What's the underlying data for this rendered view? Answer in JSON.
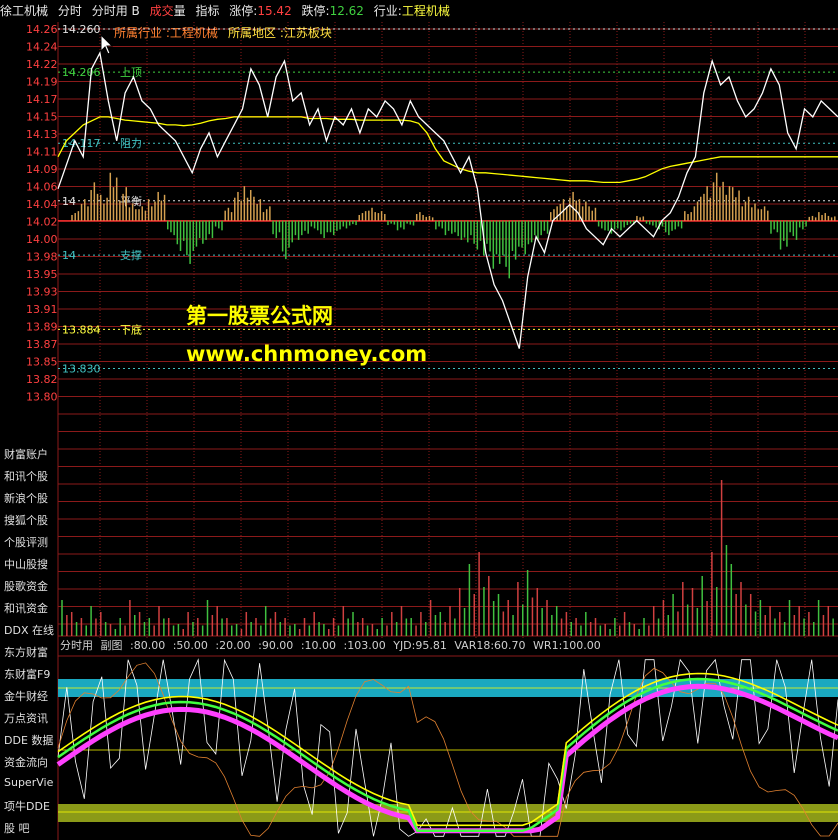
{
  "titlebar": {
    "stock_name": "徐工机械",
    "tab_intraday": "分时",
    "tab_intraday_volume": "分时用",
    "tab_b": "B",
    "tab_volume_a": "成交",
    "tab_volume_b": "量",
    "tab_indicator": "指标",
    "limit_up_label": "涨停:",
    "limit_up_value": "15.42",
    "limit_down_label": "跌停:",
    "limit_down_value": "12.62",
    "industry_label": "行业:",
    "industry_value": "工程机械"
  },
  "info_line": {
    "industry": "所属行业 :工程机械",
    "region": "所属地区 :江苏板块"
  },
  "price_axis": [
    "14.26",
    "14.24",
    "14.22",
    "14.19",
    "14.17",
    "14.15",
    "14.13",
    "14.11",
    "14.09",
    "14.06",
    "14.04",
    "14.02",
    "14.00",
    "13.98",
    "13.95",
    "13.93",
    "13.91",
    "13.89",
    "13.87",
    "13.85",
    "13.82",
    "13.80"
  ],
  "levels": [
    {
      "value": "14.260",
      "label": "",
      "color": "#e0e0e0",
      "price": 14.26
    },
    {
      "value": "14.206",
      "label": "上顶",
      "color": "#40d040",
      "price": 14.206
    },
    {
      "value": "14.117",
      "label": "阻力",
      "color": "#40c0c0",
      "price": 14.117
    },
    {
      "value": "14",
      "label": "平衡",
      "color": "#e0e0e0",
      "price": 14.045
    },
    {
      "value": "14",
      "label": "支撑",
      "color": "#40c0c0",
      "price": 13.977
    },
    {
      "value": "13.884",
      "label": "下底",
      "color": "#ffff40",
      "price": 13.884
    },
    {
      "value": "13.830",
      "label": "",
      "color": "#40c0c0",
      "price": 13.835
    }
  ],
  "watermark": {
    "line1": "第一股票公式网",
    "line2": "www.chnmoney.com"
  },
  "left_links": [
    "财富账户",
    "和讯个股",
    "新浪个股",
    "搜狐个股",
    "个股评测",
    "中山股搜",
    "股歌资金",
    "和讯资金",
    "DDX 在线",
    "东方财富",
    "东财富F9",
    "金牛财经",
    "万点资讯",
    "DDE 数据",
    "资金流向",
    "SuperVie",
    "项牛DDE",
    "股  吧"
  ],
  "subchart_header": {
    "name": "分时用",
    "mode": "副图",
    "params": [
      ":80.00",
      ":50.00",
      ":20.00",
      ":90.00",
      ":10.00",
      ":103.00"
    ],
    "yjd": "YJD:95.81",
    "var18": "VAR18:60.70",
    "wr1": "WR1:100.00"
  },
  "colors": {
    "price_line": "#ffffff",
    "avg_line": "#ffff00",
    "grid": "#8b1a1a",
    "up_bar": "#d4a050",
    "down_bar": "#40c040",
    "band_top": "#1aa8c0",
    "band_bottom": "#8b9a18"
  },
  "price_series": [
    14.06,
    14.09,
    14.12,
    14.1,
    14.21,
    14.23,
    14.17,
    14.12,
    14.18,
    14.2,
    14.17,
    14.16,
    14.14,
    14.13,
    14.12,
    14.1,
    14.08,
    14.11,
    14.13,
    14.1,
    14.12,
    14.14,
    14.16,
    14.21,
    14.19,
    14.15,
    14.2,
    14.22,
    14.17,
    14.18,
    14.14,
    14.16,
    14.12,
    14.15,
    14.14,
    14.16,
    14.13,
    14.16,
    14.15,
    14.17,
    14.16,
    14.14,
    14.17,
    14.15,
    14.14,
    14.13,
    14.12,
    14.1,
    14.08,
    14.1,
    14.06,
    13.98,
    13.94,
    13.92,
    13.89,
    13.86,
    13.95,
    14.0,
    13.98,
    14.02,
    14.03,
    14.04,
    14.03,
    14.01,
    14.0,
    13.99,
    14.01,
    14.0,
    14.01,
    14.02,
    14.01,
    14.0,
    14.02,
    14.03,
    14.05,
    14.08,
    14.1,
    14.18,
    14.22,
    14.19,
    14.2,
    14.17,
    14.15,
    14.16,
    14.18,
    14.21,
    14.19,
    14.13,
    14.11,
    14.16,
    14.15,
    14.17,
    14.16,
    14.15
  ],
  "avg_series": [
    14.1,
    14.12,
    14.13,
    14.14,
    14.145,
    14.15,
    14.15,
    14.148,
    14.146,
    14.145,
    14.144,
    14.143,
    14.142,
    14.14,
    14.14,
    14.139,
    14.14,
    14.142,
    14.145,
    14.147,
    14.148,
    14.15,
    14.15,
    14.15,
    14.15,
    14.15,
    14.15,
    14.15,
    14.15,
    14.15,
    14.148,
    14.148,
    14.148,
    14.147,
    14.147,
    14.147,
    14.146,
    14.146,
    14.146,
    14.146,
    14.146,
    14.146,
    14.145,
    14.142,
    14.13,
    14.11,
    14.095,
    14.09,
    14.085,
    14.082,
    14.08,
    14.08,
    14.079,
    14.078,
    14.077,
    14.076,
    14.075,
    14.074,
    14.073,
    14.072,
    14.071,
    14.07,
    14.07,
    14.07,
    14.069,
    14.068,
    14.068,
    14.068,
    14.07,
    14.072,
    14.075,
    14.08,
    14.085,
    14.088,
    14.09,
    14.092,
    14.094,
    14.096,
    14.098,
    14.1,
    14.1,
    14.1,
    14.1,
    14.1,
    14.1,
    14.1,
    14.1,
    14.1,
    14.1,
    14.1,
    14.1,
    14.1,
    14.1,
    14.1
  ],
  "flow_bars": [
    0.2,
    0.5,
    0.8,
    0.6,
    1.0,
    0.7,
    0.4,
    0.3,
    0.5,
    0.6,
    -0.3,
    -0.7,
    -0.9,
    -0.6,
    -0.4,
    -0.2,
    0.3,
    0.6,
    0.8,
    0.5,
    0.3,
    -0.4,
    -0.8,
    -0.5,
    -0.3,
    -0.2,
    -0.4,
    -0.3,
    -0.2,
    -0.1,
    0.2,
    0.3,
    0.2,
    -0.1,
    -0.2,
    -0.1,
    0.2,
    0.1,
    -0.2,
    -0.3,
    -0.4,
    -0.5,
    -0.6,
    -0.8,
    -1.0,
    -1.2,
    -0.9,
    -0.7,
    -0.5,
    -0.3,
    0.3,
    0.5,
    0.6,
    0.5,
    0.3,
    -0.2,
    -0.3,
    -0.2,
    -0.1,
    0.1,
    -0.1,
    -0.2,
    -0.3,
    -0.2,
    0.2,
    0.5,
    0.8,
    1.0,
    0.9,
    0.7,
    0.5,
    0.4,
    0.3,
    -0.3,
    -0.6,
    -0.4,
    -0.2,
    0.1,
    0.2,
    0.1
  ],
  "volume_series": [
    6,
    4,
    3,
    5,
    4,
    2,
    3,
    6,
    4,
    3,
    5,
    3,
    2,
    4,
    3,
    6,
    5,
    3,
    2,
    4,
    3,
    5,
    4,
    3,
    2,
    3,
    4,
    2,
    3,
    5,
    4,
    3,
    2,
    3,
    4,
    5,
    3,
    4,
    6,
    4,
    5,
    8,
    12,
    14,
    10,
    7,
    6,
    9,
    11,
    8,
    6,
    5,
    4,
    3,
    4,
    3,
    2,
    3,
    4,
    2,
    3,
    5,
    6,
    7,
    9,
    8,
    10,
    14,
    26,
    12,
    9,
    7,
    6,
    5,
    4,
    6,
    5,
    4,
    6,
    5
  ]
}
